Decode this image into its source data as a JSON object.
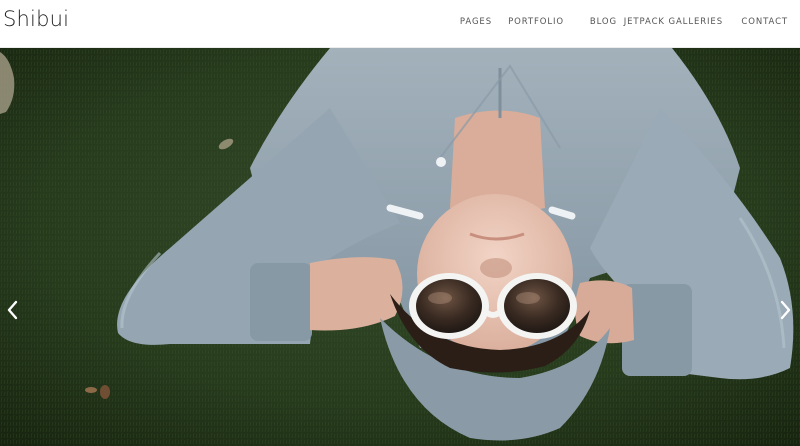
{
  "site": {
    "title": "Shibui"
  },
  "nav": {
    "items": [
      {
        "label": "PAGES"
      },
      {
        "label": "PORTFOLIO"
      },
      {
        "label": "BLOG"
      },
      {
        "label": "JETPACK GALLERIES"
      },
      {
        "label": "CONTACT"
      }
    ]
  },
  "hero": {
    "image_subject": "person in grey hoodie and white sunglasses lying on grass",
    "prev_icon": "chevron-left-icon",
    "next_icon": "chevron-right-icon"
  },
  "colors": {
    "header_bg": "#ffffff",
    "title_text": "#222222",
    "nav_text": "#555555",
    "grass": "#2a3d1c",
    "hoodie": "#97a7b3"
  }
}
